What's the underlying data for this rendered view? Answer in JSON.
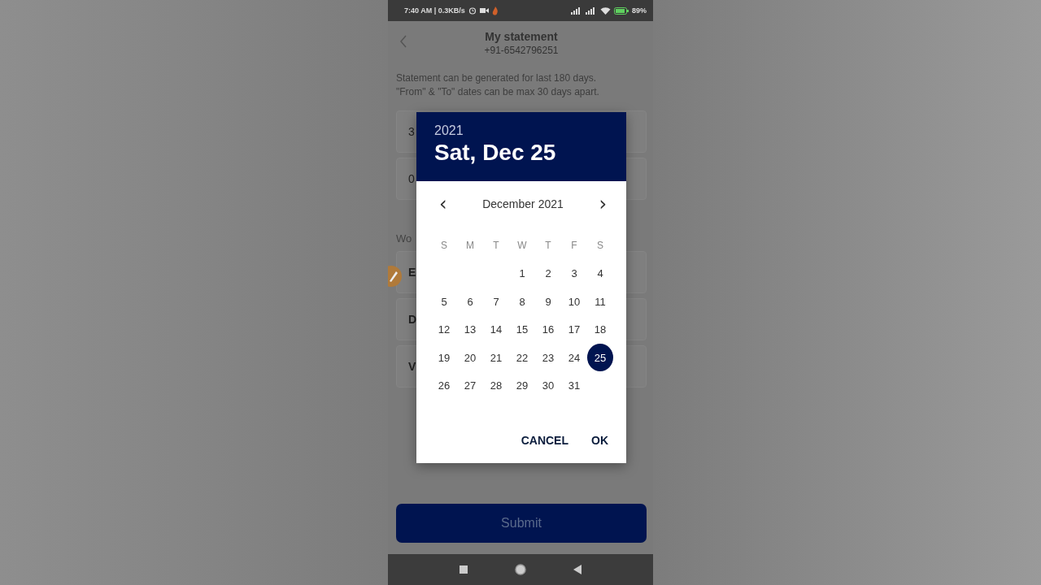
{
  "status_bar": {
    "time": "7:40 AM | 0.3KB/s",
    "battery": "89%"
  },
  "header": {
    "title": "My statement",
    "subtitle": "+91-6542796251"
  },
  "notice": [
    "Statement can be generated for last 180 days.",
    "\"From\" & \"To\" dates can be max 30 days apart."
  ],
  "date_fields": [
    {
      "value": "3"
    },
    {
      "value": "0"
    }
  ],
  "section_label": "Wo",
  "options": [
    {
      "label": "E"
    },
    {
      "label": "D"
    },
    {
      "label": "V"
    }
  ],
  "submit": "Submit",
  "date_picker": {
    "year": "2021",
    "date": "Sat, Dec 25",
    "month": "December 2021",
    "prev": "‹",
    "next": "›",
    "weekdays": [
      "S",
      "M",
      "T",
      "W",
      "T",
      "F",
      "S"
    ],
    "weeks": [
      {
        "kind": "first",
        "days": [
          {
            "day": "1",
            "selected": false
          },
          {
            "day": "2",
            "selected": false
          },
          {
            "day": "3",
            "selected": false
          },
          {
            "day": "4",
            "selected": false
          }
        ]
      },
      {
        "kind": "week",
        "days": [
          {
            "day": "5",
            "selected": false
          },
          {
            "day": "6",
            "selected": false
          },
          {
            "day": "7",
            "selected": false
          },
          {
            "day": "8",
            "selected": false
          },
          {
            "day": "9",
            "selected": false
          },
          {
            "day": "10",
            "selected": false
          },
          {
            "day": "11",
            "selected": false
          }
        ]
      },
      {
        "kind": "week",
        "days": [
          {
            "day": "12",
            "selected": false
          },
          {
            "day": "13",
            "selected": false
          },
          {
            "day": "14",
            "selected": false
          },
          {
            "day": "15",
            "selected": false
          },
          {
            "day": "16",
            "selected": false
          },
          {
            "day": "17",
            "selected": false
          },
          {
            "day": "18",
            "selected": false
          }
        ]
      },
      {
        "kind": "week",
        "days": [
          {
            "day": "19",
            "selected": false
          },
          {
            "day": "20",
            "selected": false
          },
          {
            "day": "21",
            "selected": false
          },
          {
            "day": "22",
            "selected": false
          },
          {
            "day": "23",
            "selected": false
          },
          {
            "day": "24",
            "selected": false
          },
          {
            "day": "25",
            "selected": true
          }
        ]
      },
      {
        "kind": "week",
        "days": [
          {
            "day": "26",
            "selected": false
          },
          {
            "day": "27",
            "selected": false
          },
          {
            "day": "28",
            "selected": false
          },
          {
            "day": "29",
            "selected": false
          },
          {
            "day": "30",
            "selected": false
          },
          {
            "day": "31",
            "selected": false
          }
        ]
      }
    ],
    "buttons": [
      "CANCEL",
      "OK"
    ]
  }
}
